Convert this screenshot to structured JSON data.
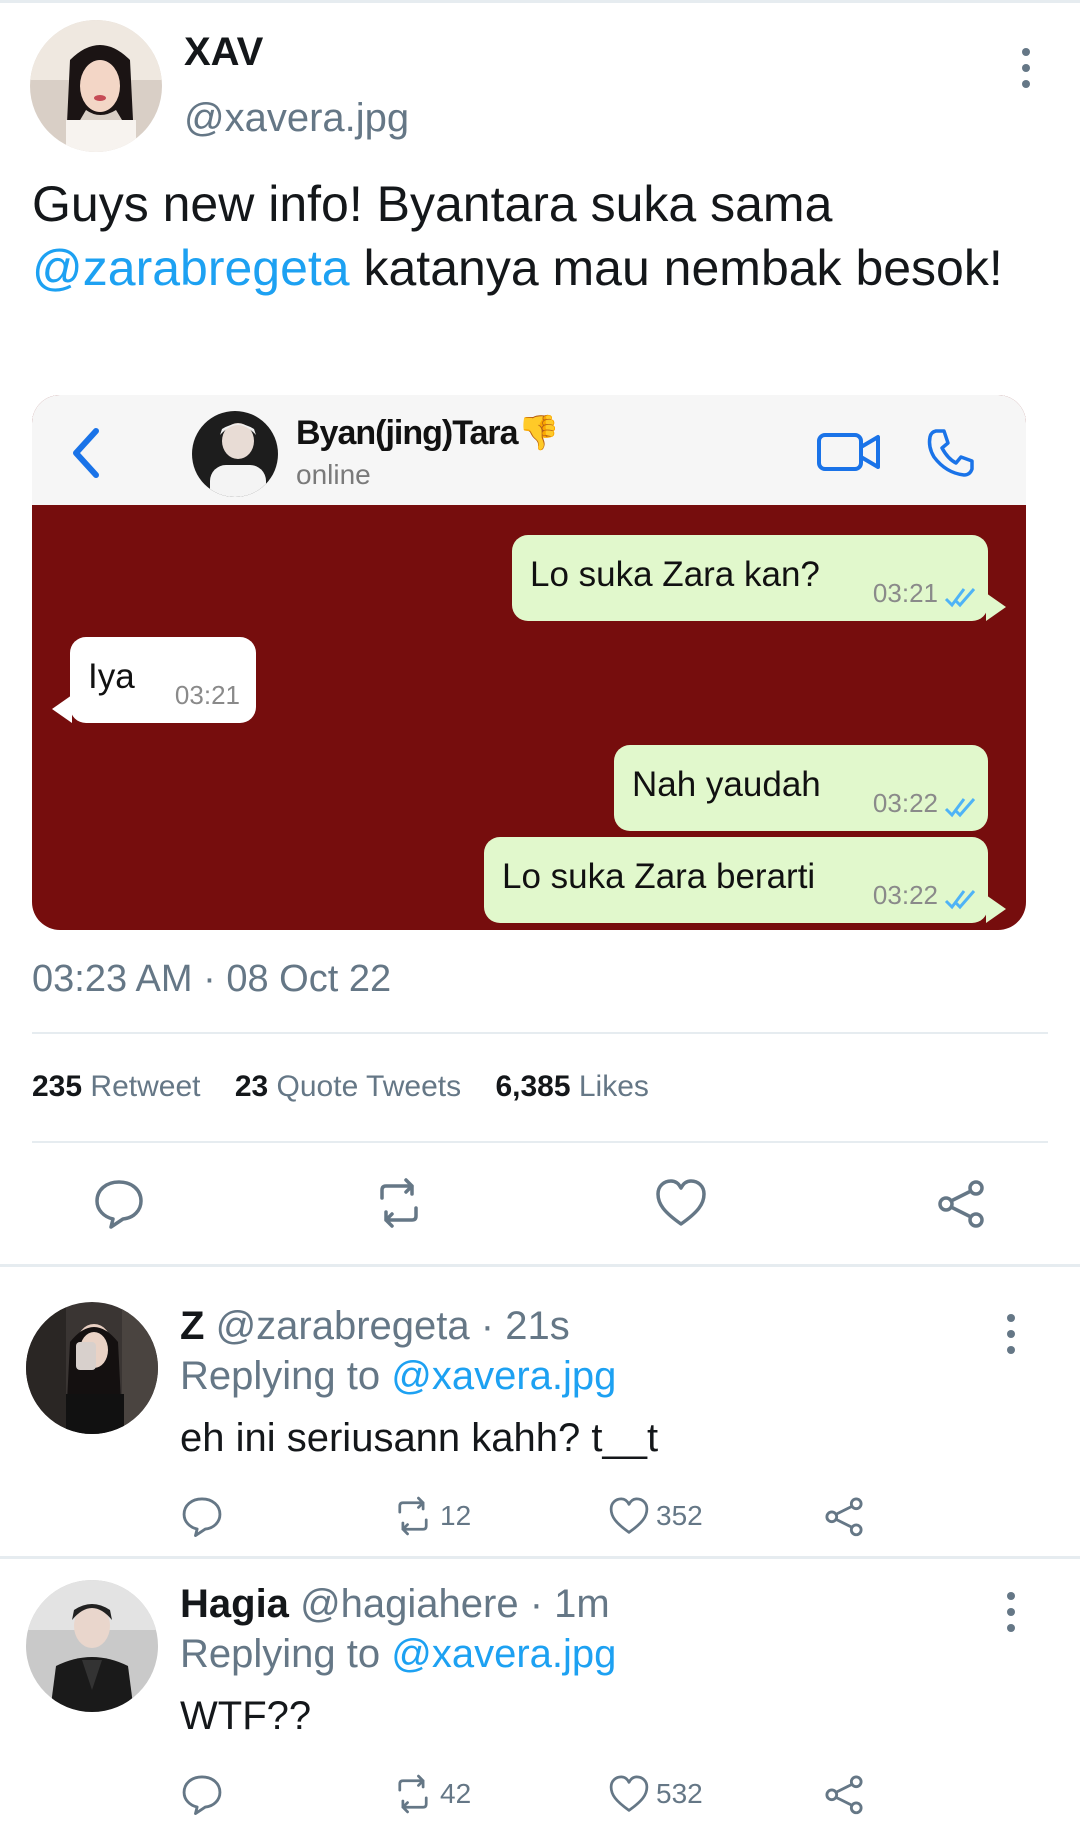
{
  "tweet": {
    "name": "XAV",
    "handle": "@xavera.jpg",
    "text_part1": "Guys new info! Byantara suka sama ",
    "mention": "@zarabregeta",
    "text_part2": " katanya mau nembak besok!",
    "timestamp": "03:23 AM · 08 Oct 22",
    "stats": {
      "retweets_count": "235",
      "retweets_label": "Retweet",
      "quotes_count": "23",
      "quotes_label": "Quote Tweets",
      "likes_count": "6,385",
      "likes_label": "Likes"
    }
  },
  "chat": {
    "contact_name": "Byan(jing)Tara",
    "status": "online",
    "background_color": "#760d0d",
    "messages": [
      {
        "direction": "out",
        "text": "Lo suka Zara kan?",
        "time": "03:21"
      },
      {
        "direction": "in",
        "text": "Iya",
        "time": "03:21"
      },
      {
        "direction": "out",
        "text": "Nah yaudah",
        "time": "03:22"
      },
      {
        "direction": "out",
        "text": "Lo suka Zara berarti",
        "time": "03:22"
      }
    ]
  },
  "replies": [
    {
      "name": "Z",
      "handle": "@zarabregeta",
      "age": "· 21s",
      "replying_label": "Replying to",
      "replying_to": "@xavera.jpg",
      "text": "eh ini seriusann kahh? t__t",
      "retweets": "12",
      "likes": "352"
    },
    {
      "name": "Hagia",
      "handle": "@hagiahere",
      "age": "· 1m",
      "replying_label": "Replying to",
      "replying_to": "@xavera.jpg",
      "text": "WTF??",
      "retweets": "42",
      "likes": "532"
    }
  ],
  "icons": {
    "reply": "speech-bubble-icon",
    "retweet": "retweet-icon",
    "like": "heart-icon",
    "share": "share-icon",
    "more": "vertical-dots-icon",
    "back": "chevron-left-icon",
    "video": "video-camera-icon",
    "phone": "phone-icon",
    "read": "double-check-icon",
    "emoji": "thumbs-down-emoji"
  },
  "colors": {
    "accent": "#1da1f2",
    "muted": "#657786",
    "bubble_out": "#e1f8cc",
    "ios_blue": "#1a73e8"
  }
}
